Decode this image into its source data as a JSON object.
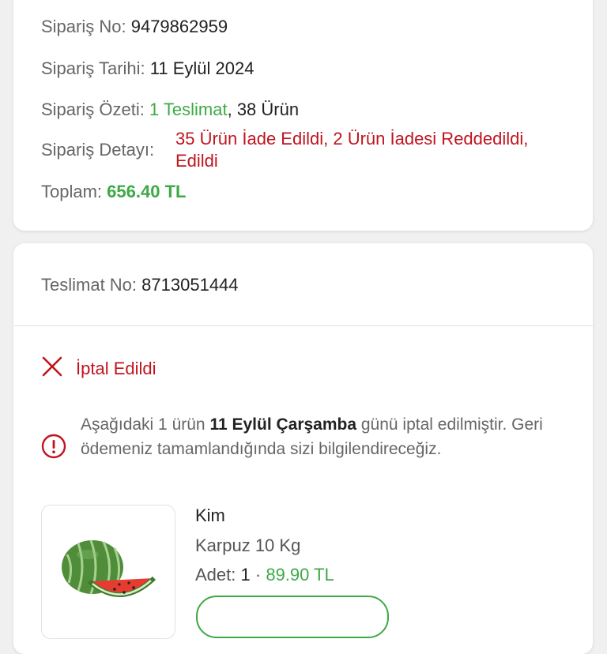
{
  "order_summary": {
    "order_no_label": "Sipariş No:",
    "order_no": "9479862959",
    "order_date_label": "Sipariş Tarihi:",
    "order_date": "11 Eylül 2024",
    "order_overview_label": "Sipariş Özeti:",
    "deliveries_link": "1 Teslimat",
    "items_count": ", 38 Ürün",
    "order_detail_label": "Sipariş Detayı:",
    "order_detail_line1": "35 Ürün İade Edildi, 2 Ürün İadesi Reddedildi,",
    "order_detail_line2": "Edildi",
    "total_label": "Toplam:",
    "total_value": "656.40 TL"
  },
  "delivery": {
    "delivery_no_label": "Teslimat No:",
    "delivery_no": "8713051444",
    "status": "İptal Edildi",
    "info_pre": "Aşağıdaki 1 ürün ",
    "info_bold": "11 Eylül Çarşamba",
    "info_post": " günü iptal edilmiştir. Geri ödemeniz tamamlandığında sizi bilgilendireceğiz.",
    "product": {
      "brand": "Kim",
      "name": "Karpuz 10 Kg",
      "qty_label": "Adet:",
      "qty": "1",
      "separator": "·",
      "price": "89.90 TL"
    }
  },
  "colors": {
    "accent_green": "#3daa46",
    "error_red": "#c0141e"
  },
  "icons": {
    "status": "close-x-icon",
    "info": "info-circle-icon",
    "product_image": "watermelon-icon"
  }
}
